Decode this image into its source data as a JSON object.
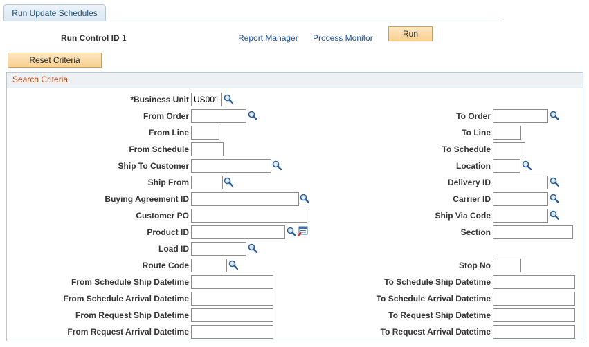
{
  "tab": {
    "label": "Run Update Schedules"
  },
  "run_control": {
    "label": "Run Control ID",
    "value": "1"
  },
  "links": {
    "report_manager": "Report Manager",
    "process_monitor": "Process Monitor"
  },
  "buttons": {
    "run": "Run",
    "reset": "Reset Criteria"
  },
  "section": {
    "title": "Search Criteria"
  },
  "fields": {
    "business_unit": {
      "label": "*Business Unit",
      "value": "US001"
    },
    "from_order": {
      "label": "From Order",
      "value": ""
    },
    "to_order": {
      "label": "To Order",
      "value": ""
    },
    "from_line": {
      "label": "From Line",
      "value": ""
    },
    "to_line": {
      "label": "To Line",
      "value": ""
    },
    "from_schedule": {
      "label": "From Schedule",
      "value": ""
    },
    "to_schedule": {
      "label": "To Schedule",
      "value": ""
    },
    "ship_to_customer": {
      "label": "Ship To Customer",
      "value": ""
    },
    "location": {
      "label": "Location",
      "value": ""
    },
    "ship_from": {
      "label": "Ship From",
      "value": ""
    },
    "delivery_id": {
      "label": "Delivery ID",
      "value": ""
    },
    "buying_agreement_id": {
      "label": "Buying Agreement ID",
      "value": ""
    },
    "carrier_id": {
      "label": "Carrier ID",
      "value": ""
    },
    "customer_po": {
      "label": "Customer PO",
      "value": ""
    },
    "ship_via_code": {
      "label": "Ship Via Code",
      "value": ""
    },
    "product_id": {
      "label": "Product ID",
      "value": ""
    },
    "section": {
      "label": "Section",
      "value": ""
    },
    "load_id": {
      "label": "Load ID",
      "value": ""
    },
    "route_code": {
      "label": "Route Code",
      "value": ""
    },
    "stop_no": {
      "label": "Stop No",
      "value": ""
    },
    "from_schedule_ship_datetime": {
      "label": "From Schedule Ship Datetime",
      "value": ""
    },
    "to_schedule_ship_datetime": {
      "label": "To Schedule Ship Datetime",
      "value": ""
    },
    "from_schedule_arrival_datetime": {
      "label": "From Schedule Arrival Datetime",
      "value": ""
    },
    "to_schedule_arrival_datetime": {
      "label": "To Schedule Arrival Datetime",
      "value": ""
    },
    "from_request_ship_datetime": {
      "label": "From Request Ship Datetime",
      "value": ""
    },
    "to_request_ship_datetime": {
      "label": "To Request Ship Datetime",
      "value": ""
    },
    "from_request_arrival_datetime": {
      "label": "From Request Arrival Datetime",
      "value": ""
    },
    "to_request_arrival_datetime": {
      "label": "To Request Arrival Datetime",
      "value": ""
    }
  },
  "icons": {
    "lookup": "magnifier-icon",
    "browse": "product-browse-icon"
  }
}
